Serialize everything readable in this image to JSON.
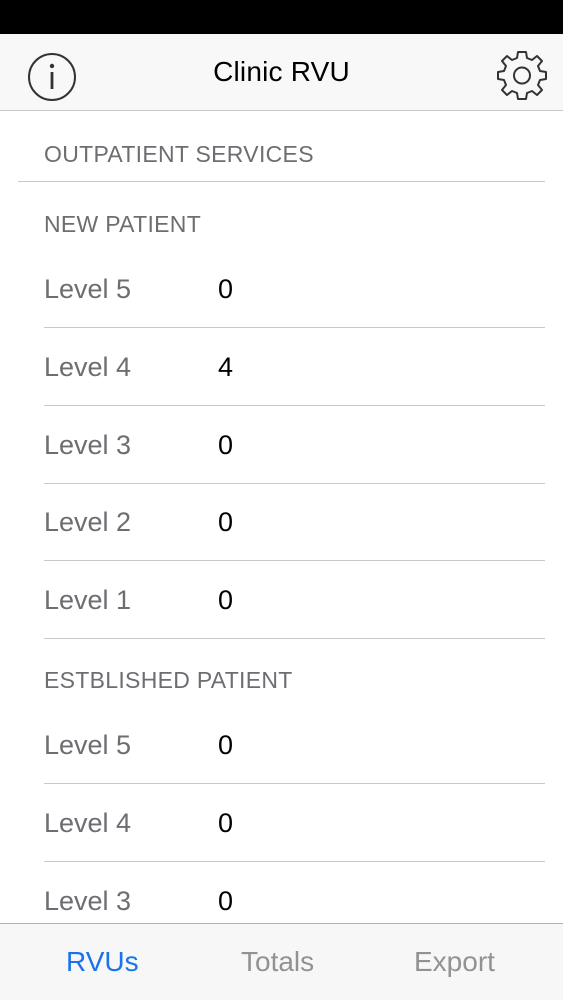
{
  "nav": {
    "title": "Clinic RVU"
  },
  "icons": {
    "info": "info-circle-icon",
    "settings": "gear-icon"
  },
  "section": {
    "title": "OUTPATIENT SERVICES"
  },
  "groups": [
    {
      "title": "NEW PATIENT",
      "rows": [
        {
          "label": "Level 5",
          "value": "0"
        },
        {
          "label": "Level 4",
          "value": "4"
        },
        {
          "label": "Level 3",
          "value": "0"
        },
        {
          "label": "Level 2",
          "value": "0"
        },
        {
          "label": "Level 1",
          "value": "0"
        }
      ]
    },
    {
      "title": "ESTBLISHED PATIENT",
      "rows": [
        {
          "label": "Level 5",
          "value": "0"
        },
        {
          "label": "Level 4",
          "value": "0"
        },
        {
          "label": "Level 3",
          "value": "0"
        }
      ]
    }
  ],
  "tabs": [
    {
      "label": "RVUs",
      "active": true
    },
    {
      "label": "Totals",
      "active": false
    },
    {
      "label": "Export",
      "active": false
    }
  ],
  "colors": {
    "accent": "#1a73e8",
    "label_gray": "#6d6d72",
    "separator": "#c8c7cc"
  }
}
